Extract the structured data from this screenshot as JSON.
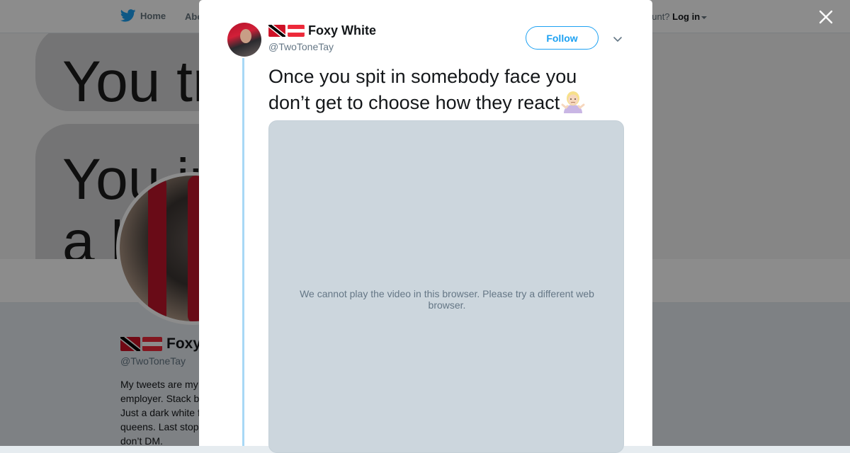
{
  "background": {
    "nav": {
      "home_label": "Home",
      "about_label": "Abo",
      "login_prefix": "ccount?",
      "login_label": "Log in"
    },
    "banner": {
      "line1": "You tra",
      "line2": "You ju",
      "line3": "a li"
    },
    "profile": {
      "name": "Foxy",
      "handle": "@TwoToneTay",
      "bio": "My tweets are my\nemployer. Stack b\nJust a dark white f\nqueens. Last stop\ndon’t DM."
    }
  },
  "tweet": {
    "author_name": "Foxy White",
    "author_handle": "@TwoToneTay",
    "follow_label": "Follow",
    "text": "Once you spit in somebody face you don’t get to choose how they react",
    "video_message": "We cannot play the video in this browser. Please try a different web browser."
  },
  "icons": [
    "twitter-bird-icon",
    "close-icon",
    "chevron-down-icon",
    "flag-icon",
    "shrug-emoji-icon"
  ],
  "colors": {
    "accent": "#1da1f2",
    "thread_line": "#a8d8f6",
    "video_placeholder": "#ccd6dd"
  }
}
